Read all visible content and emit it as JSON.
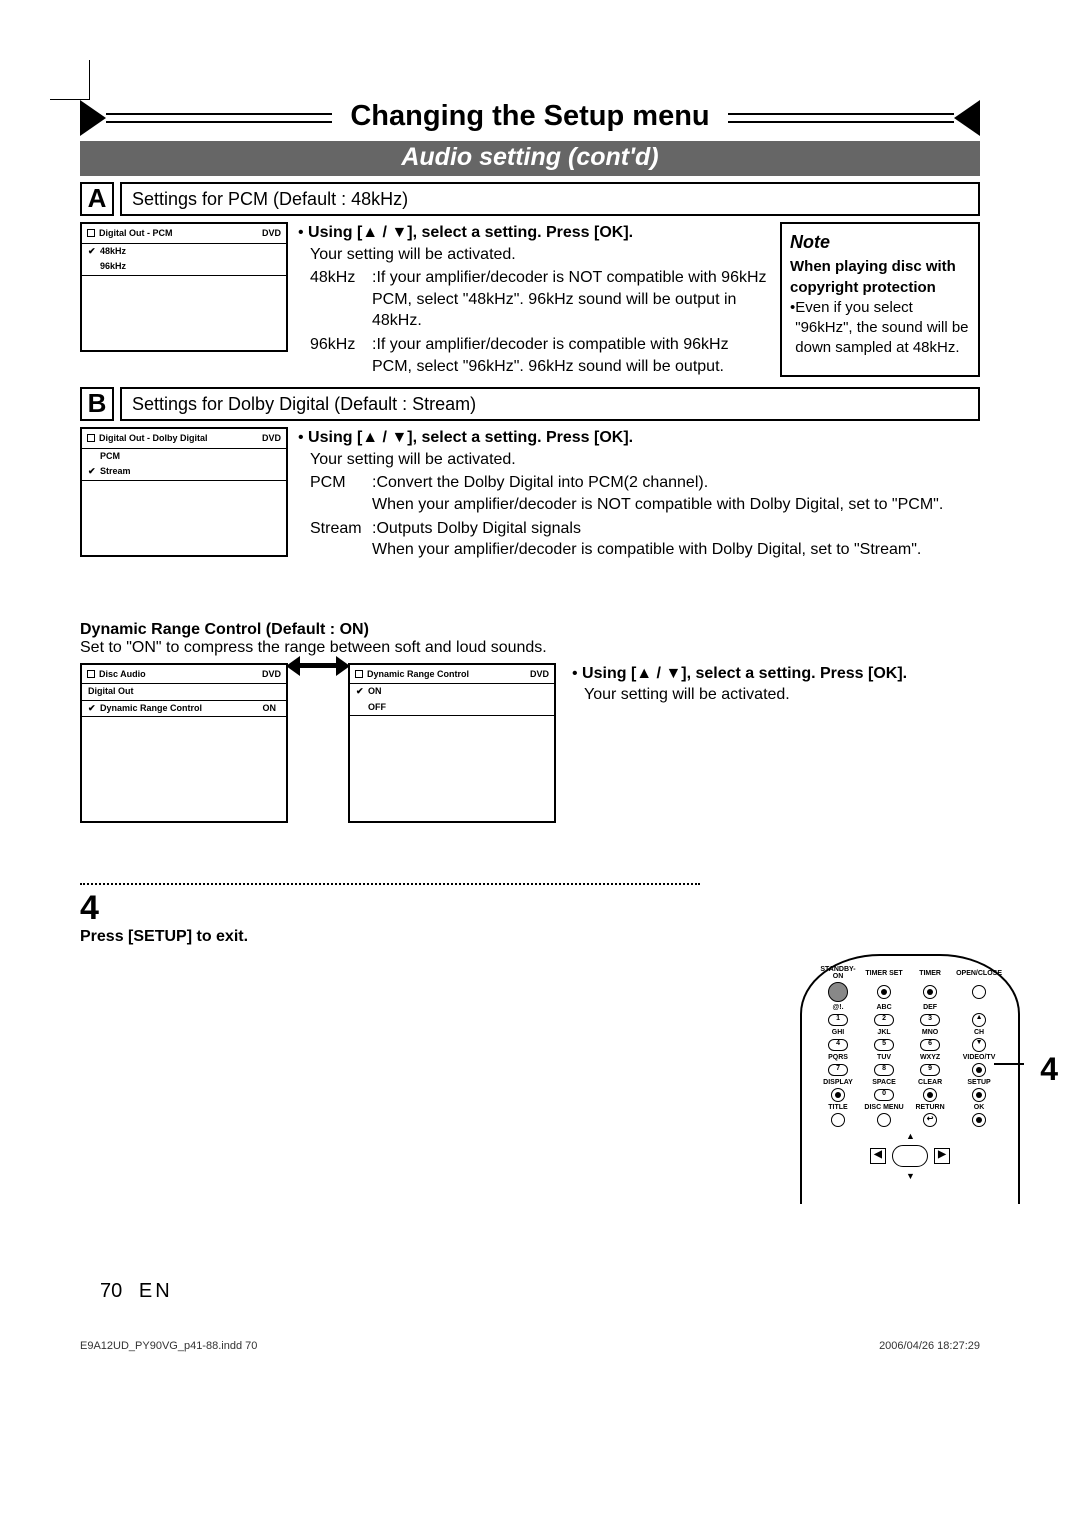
{
  "header": {
    "title": "Changing the Setup menu",
    "subtitle": "Audio setting (cont'd)"
  },
  "sectionA": {
    "letter": "A",
    "title": "Settings for PCM (Default : 48kHz)",
    "osd": {
      "header": "Digital Out - PCM",
      "badge": "DVD",
      "row1": "48kHz",
      "row2": "96kHz"
    },
    "instr": "Using [▲ / ▼], select a setting. Press [OK].",
    "line1": "Your setting will be activated.",
    "k1": "48kHz",
    "v1": ":If your amplifier/decoder is NOT compatible with 96kHz PCM, select \"48kHz\". 96kHz sound will be output in 48kHz.",
    "k2": "96kHz",
    "v2": ":If your amplifier/decoder is compatible with 96kHz PCM, select \"96kHz\". 96kHz sound will be output."
  },
  "note": {
    "title": "Note",
    "h": "When playing disc with copyright protection",
    "bullet": "Even if you select \"96kHz\", the sound will be down sampled at 48kHz."
  },
  "sectionB": {
    "letter": "B",
    "title": "Settings for Dolby Digital (Default : Stream)",
    "osd": {
      "header": "Digital Out - Dolby Digital",
      "badge": "DVD",
      "row1": "PCM",
      "row2": "Stream"
    },
    "instr": "Using [▲ / ▼], select a setting. Press [OK].",
    "line1": "Your setting will be activated.",
    "k1": "PCM",
    "v1": ":Convert the Dolby Digital into PCM(2 channel).",
    "v1b": "When your amplifier/decoder is NOT compatible with Dolby Digital, set to \"PCM\".",
    "k2": "Stream",
    "v2": ":Outputs Dolby Digital signals",
    "v2b": "When your amplifier/decoder is compatible with Dolby Digital, set to \"Stream\"."
  },
  "drc": {
    "heading": "Dynamic Range Control (Default : ON)",
    "sub": "Set to \"ON\" to compress the range between soft and loud sounds.",
    "osd1": {
      "header": "Disc Audio",
      "badge": "DVD",
      "row1": "Digital Out",
      "row2": "Dynamic Range Control",
      "row2v": "ON"
    },
    "osd2": {
      "header": "Dynamic Range Control",
      "badge": "DVD",
      "row1": "ON",
      "row2": "OFF"
    },
    "instr": "Using [▲ / ▼], select a setting. Press [OK].",
    "line1": "Your setting will be activated."
  },
  "step4": {
    "num": "4",
    "text": "Press [SETUP] to exit."
  },
  "remote": {
    "labels": [
      "STANDBY-ON",
      "TIMER SET",
      "TIMER",
      "OPEN/CLOSE",
      "@!.",
      "ABC",
      "DEF",
      "",
      "GHI",
      "JKL",
      "MNO",
      "CH",
      "PQRS",
      "TUV",
      "WXYZ",
      "VIDEO/TV",
      "DISPLAY",
      "SPACE",
      "CLEAR",
      "SETUP",
      "TITLE",
      "DISC MENU",
      "RETURN",
      "OK"
    ],
    "nums": [
      "1",
      "2",
      "3",
      "4",
      "5",
      "6",
      "7",
      "8",
      "9",
      "0"
    ],
    "callout": "4"
  },
  "footer": {
    "page": "70",
    "lang": "EN",
    "file": "E9A12UD_PY90VG_p41-88.indd   70",
    "ts": "2006/04/26   18:27:29"
  }
}
